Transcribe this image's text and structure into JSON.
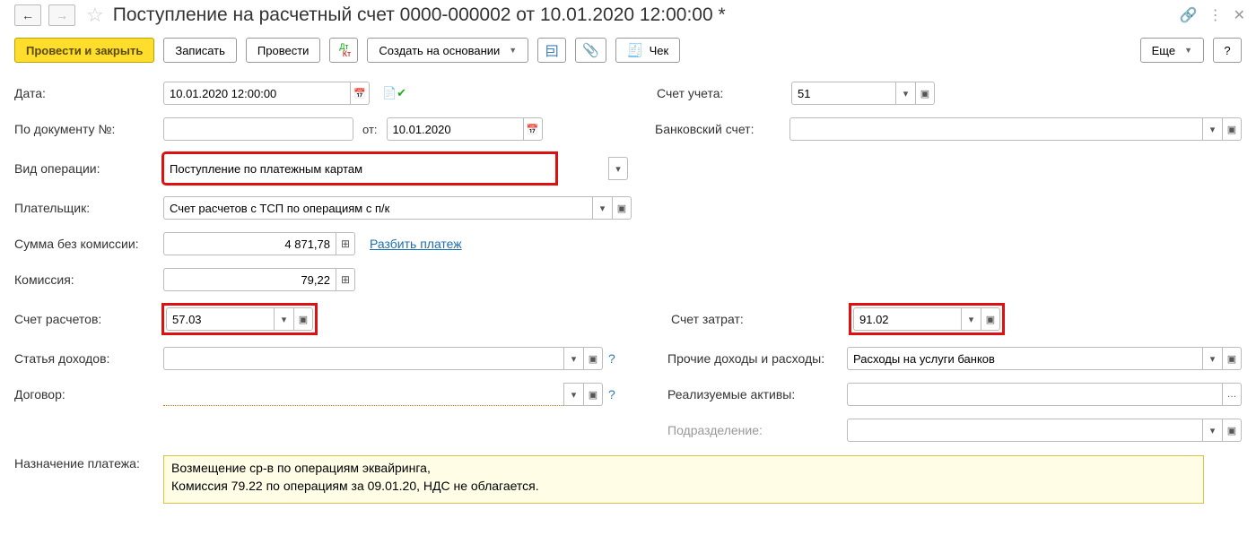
{
  "header": {
    "title": "Поступление на расчетный счет 0000-000002 от 10.01.2020 12:00:00 *"
  },
  "toolbar": {
    "post_close": "Провести и закрыть",
    "write": "Записать",
    "post": "Провести",
    "create_on_basis": "Создать на основании",
    "check": "Чек",
    "more": "Еще",
    "help": "?"
  },
  "form": {
    "date_label": "Дата:",
    "date_value": "10.01.2020 12:00:00",
    "account_label": "Счет учета:",
    "account_value": "51",
    "docnum_label": "По документу №:",
    "docnum_value": "",
    "docnum_from": "от:",
    "docnum_from_value": "10.01.2020",
    "bank_acc_label": "Банковский счет:",
    "bank_acc_value": "",
    "optype_label": "Вид операции:",
    "optype_value": "Поступление по платежным картам",
    "payer_label": "Плательщик:",
    "payer_value": "Счет расчетов с ТСП по операциям с п/к",
    "sum_no_comm_label": "Сумма без комиссии:",
    "sum_no_comm_value": "4 871,78",
    "split_link": "Разбить платеж",
    "commission_label": "Комиссия:",
    "commission_value": "79,22",
    "settlement_acc_label": "Счет расчетов:",
    "settlement_acc_value": "57.03",
    "expense_acc_label": "Счет затрат:",
    "expense_acc_value": "91.02",
    "income_item_label": "Статья доходов:",
    "income_item_value": "",
    "other_ie_label": "Прочие доходы и расходы:",
    "other_ie_value": "Расходы на услуги банков",
    "contract_label": "Договор:",
    "contract_value": "",
    "realized_assets_label": "Реализуемые активы:",
    "realized_assets_value": "",
    "subdivision_label": "Подразделение:",
    "subdivision_value": "",
    "purpose_label": "Назначение платежа:",
    "purpose_value": "Возмещение ср-в по операциям эквайринга,\nКомиссия 79.22 по операциям за 09.01.20, НДС не облагается."
  }
}
